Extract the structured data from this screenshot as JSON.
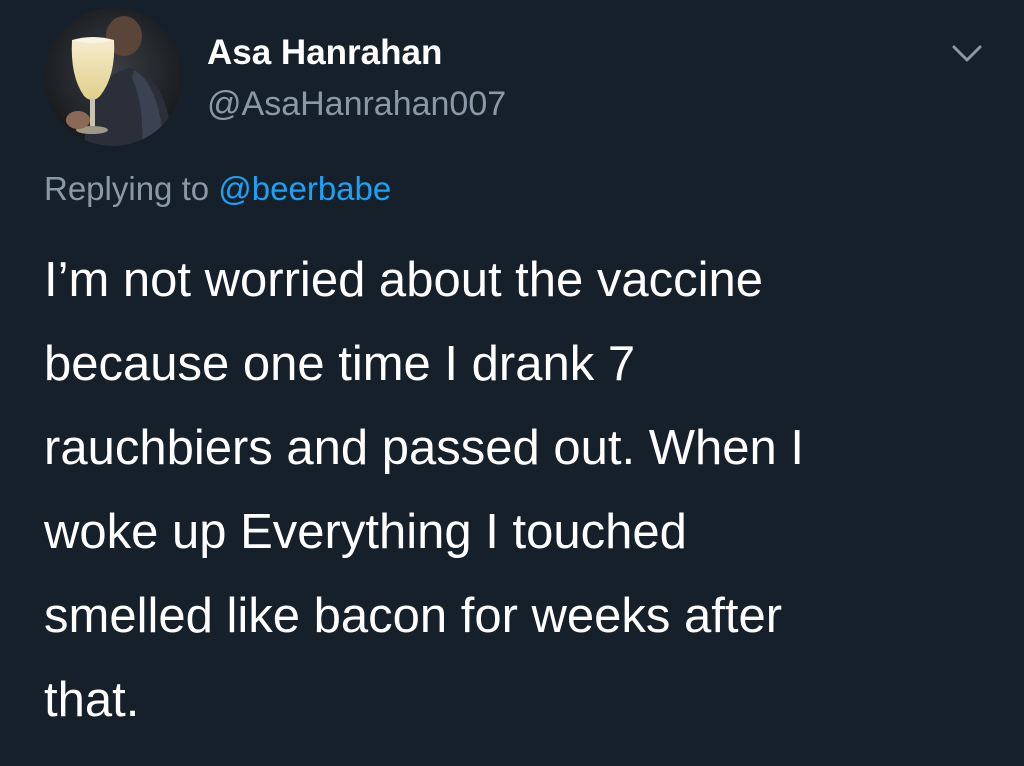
{
  "tweet": {
    "author": {
      "display_name": "Asa Hanrahan",
      "handle": "@AsaHanrahan007",
      "avatar_icon": "profile-photo-beer-glass"
    },
    "menu_icon": "chevron-down-icon",
    "reply": {
      "prefix": "Replying to",
      "mention": "@beerbabe"
    },
    "body_lines": [
      "I’m not worried about the vaccine",
      "because one time I drank 7",
      "rauchbiers and passed out. When I",
      "woke up Everything I touched",
      "smelled like bacon for weeks after",
      "that."
    ]
  },
  "colors": {
    "background": "#15202b",
    "text_primary": "#ffffff",
    "text_secondary": "#8b98a5",
    "accent": "#1da1f2"
  }
}
